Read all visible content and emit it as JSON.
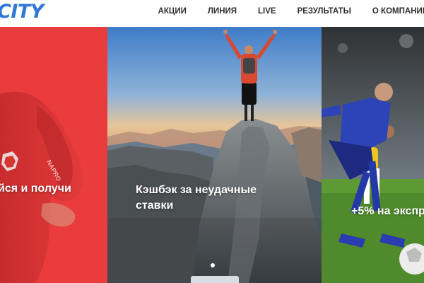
{
  "header": {
    "logo_text": "CITY",
    "brand_color": "#2f78d6",
    "nav": [
      {
        "label": "АКЦИИ"
      },
      {
        "label": "ЛИНИЯ"
      },
      {
        "label": "LIVE"
      },
      {
        "label": "РЕЗУЛЬТАТЫ"
      },
      {
        "label": "О КОМПАНИИ"
      }
    ]
  },
  "slider": {
    "slides": [
      {
        "caption": "йся и получи",
        "background": "#ea3c3c"
      },
      {
        "caption_line1": "Кэшбэк за неудачные",
        "caption_line2": "ставки"
      },
      {
        "caption": "+5% на экспр"
      }
    ],
    "active_dot": 0
  },
  "icons": {
    "slider_dot": "circle"
  }
}
